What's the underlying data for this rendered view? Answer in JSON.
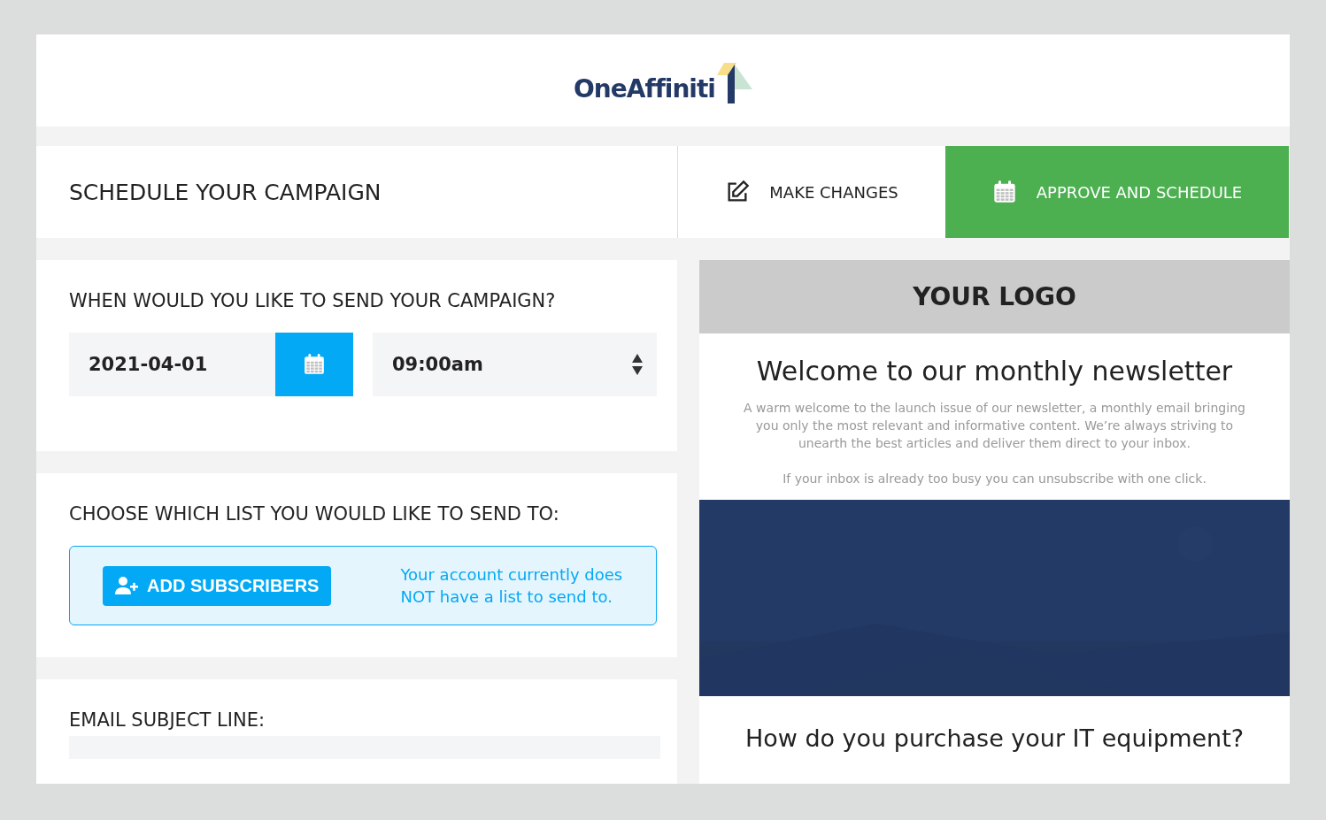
{
  "header": {
    "logo": "OneAffiniti"
  },
  "toolbar": {
    "title": "SCHEDULE YOUR CAMPAIGN",
    "buttons": [
      {
        "kind": "edit",
        "label": "MAKE CHANGES"
      },
      {
        "kind": "approve",
        "label": "APPROVE AND SCHEDULE"
      }
    ]
  },
  "schedule": {
    "heading": "WHEN WOULD YOU LIKE TO SEND YOUR CAMPAIGN?",
    "date": "2021-04-01",
    "time": "09:00am"
  },
  "list": {
    "heading": "CHOOSE WHICH LIST YOU WOULD LIKE TO SEND TO:",
    "button": "ADD SUBSCRIBERS",
    "notice": "Your account currently does NOT have a list to send to."
  },
  "subject": {
    "heading": "EMAIL SUBJECT LINE:"
  },
  "preview": {
    "logo": "YOUR LOGO",
    "title": "Welcome to our monthly newsletter",
    "paragraphs": [
      "A warm welcome to the launch issue of our newsletter, a monthly email bringing you only the most relevant and informative content. We’re always striving to unearth the best articles and deliver them direct to your inbox.",
      "If your inbox is already too busy you can unsubscribe with one click."
    ],
    "question": "How do you purchase your IT equipment?"
  }
}
